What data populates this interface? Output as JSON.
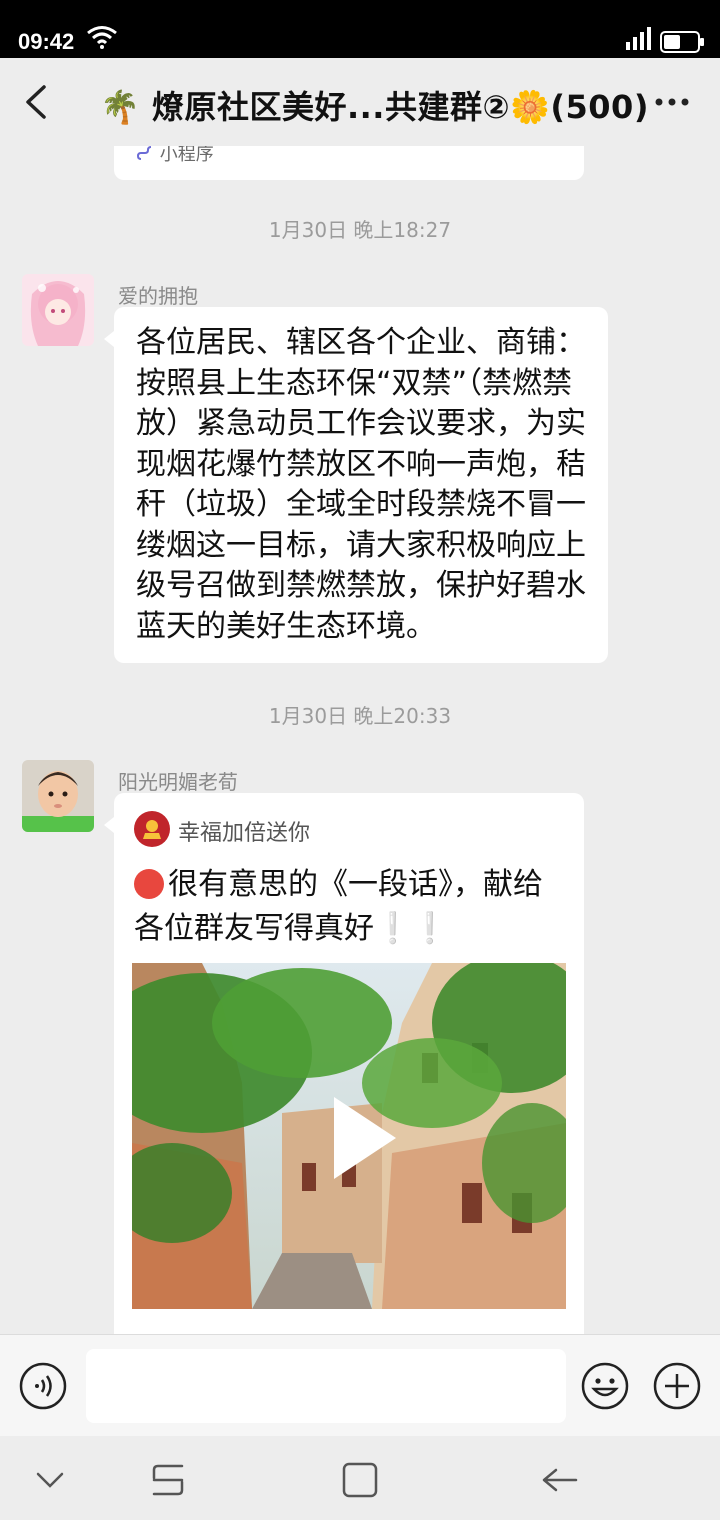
{
  "status_bar": {
    "time": "09:42",
    "network": "4G"
  },
  "header": {
    "title": "🌴 燎原社区美好...共建群②🌼(500)"
  },
  "prev_card": {
    "mini_program_label": "小程序"
  },
  "messages": [
    {
      "timestamp": "1月30日 晚上18:27",
      "sender": "爱的拥抱",
      "text": "各位居民、辖区各个企业、商铺：按照县上生态环保“双禁”（禁燃禁放）紧急动员工作会议要求，为实现烟花爆竹禁放区不响一声炮，秸秆（垃圾）全域全时段禁烧不冒一缕烟这一目标，请大家积极响应上级号召做到禁燃禁放，保护好碧水蓝天的美好生态环境。"
    },
    {
      "timestamp": "1月30日 晚上20:33",
      "sender": "阳光明媚老荀",
      "card_source": "幸福加倍送你",
      "card_title": "很有意思的《一段话》，献给各位群友写得真好",
      "card_excl": "❕❕"
    }
  ],
  "input": {
    "placeholder": ""
  },
  "colors": {
    "background": "#ededed",
    "bubble": "#ffffff",
    "timestamp": "#9b9b9b",
    "red_dot": "#e8473e",
    "exclamation": "#4bb8d6"
  },
  "icons": [
    "wifi-icon",
    "signal-icon",
    "battery-icon",
    "back-arrow-icon",
    "more-icon",
    "voice-icon",
    "emoji-icon",
    "plus-icon",
    "nav-down-icon",
    "nav-recent-icon",
    "nav-home-icon",
    "nav-back-icon",
    "play-icon"
  ]
}
